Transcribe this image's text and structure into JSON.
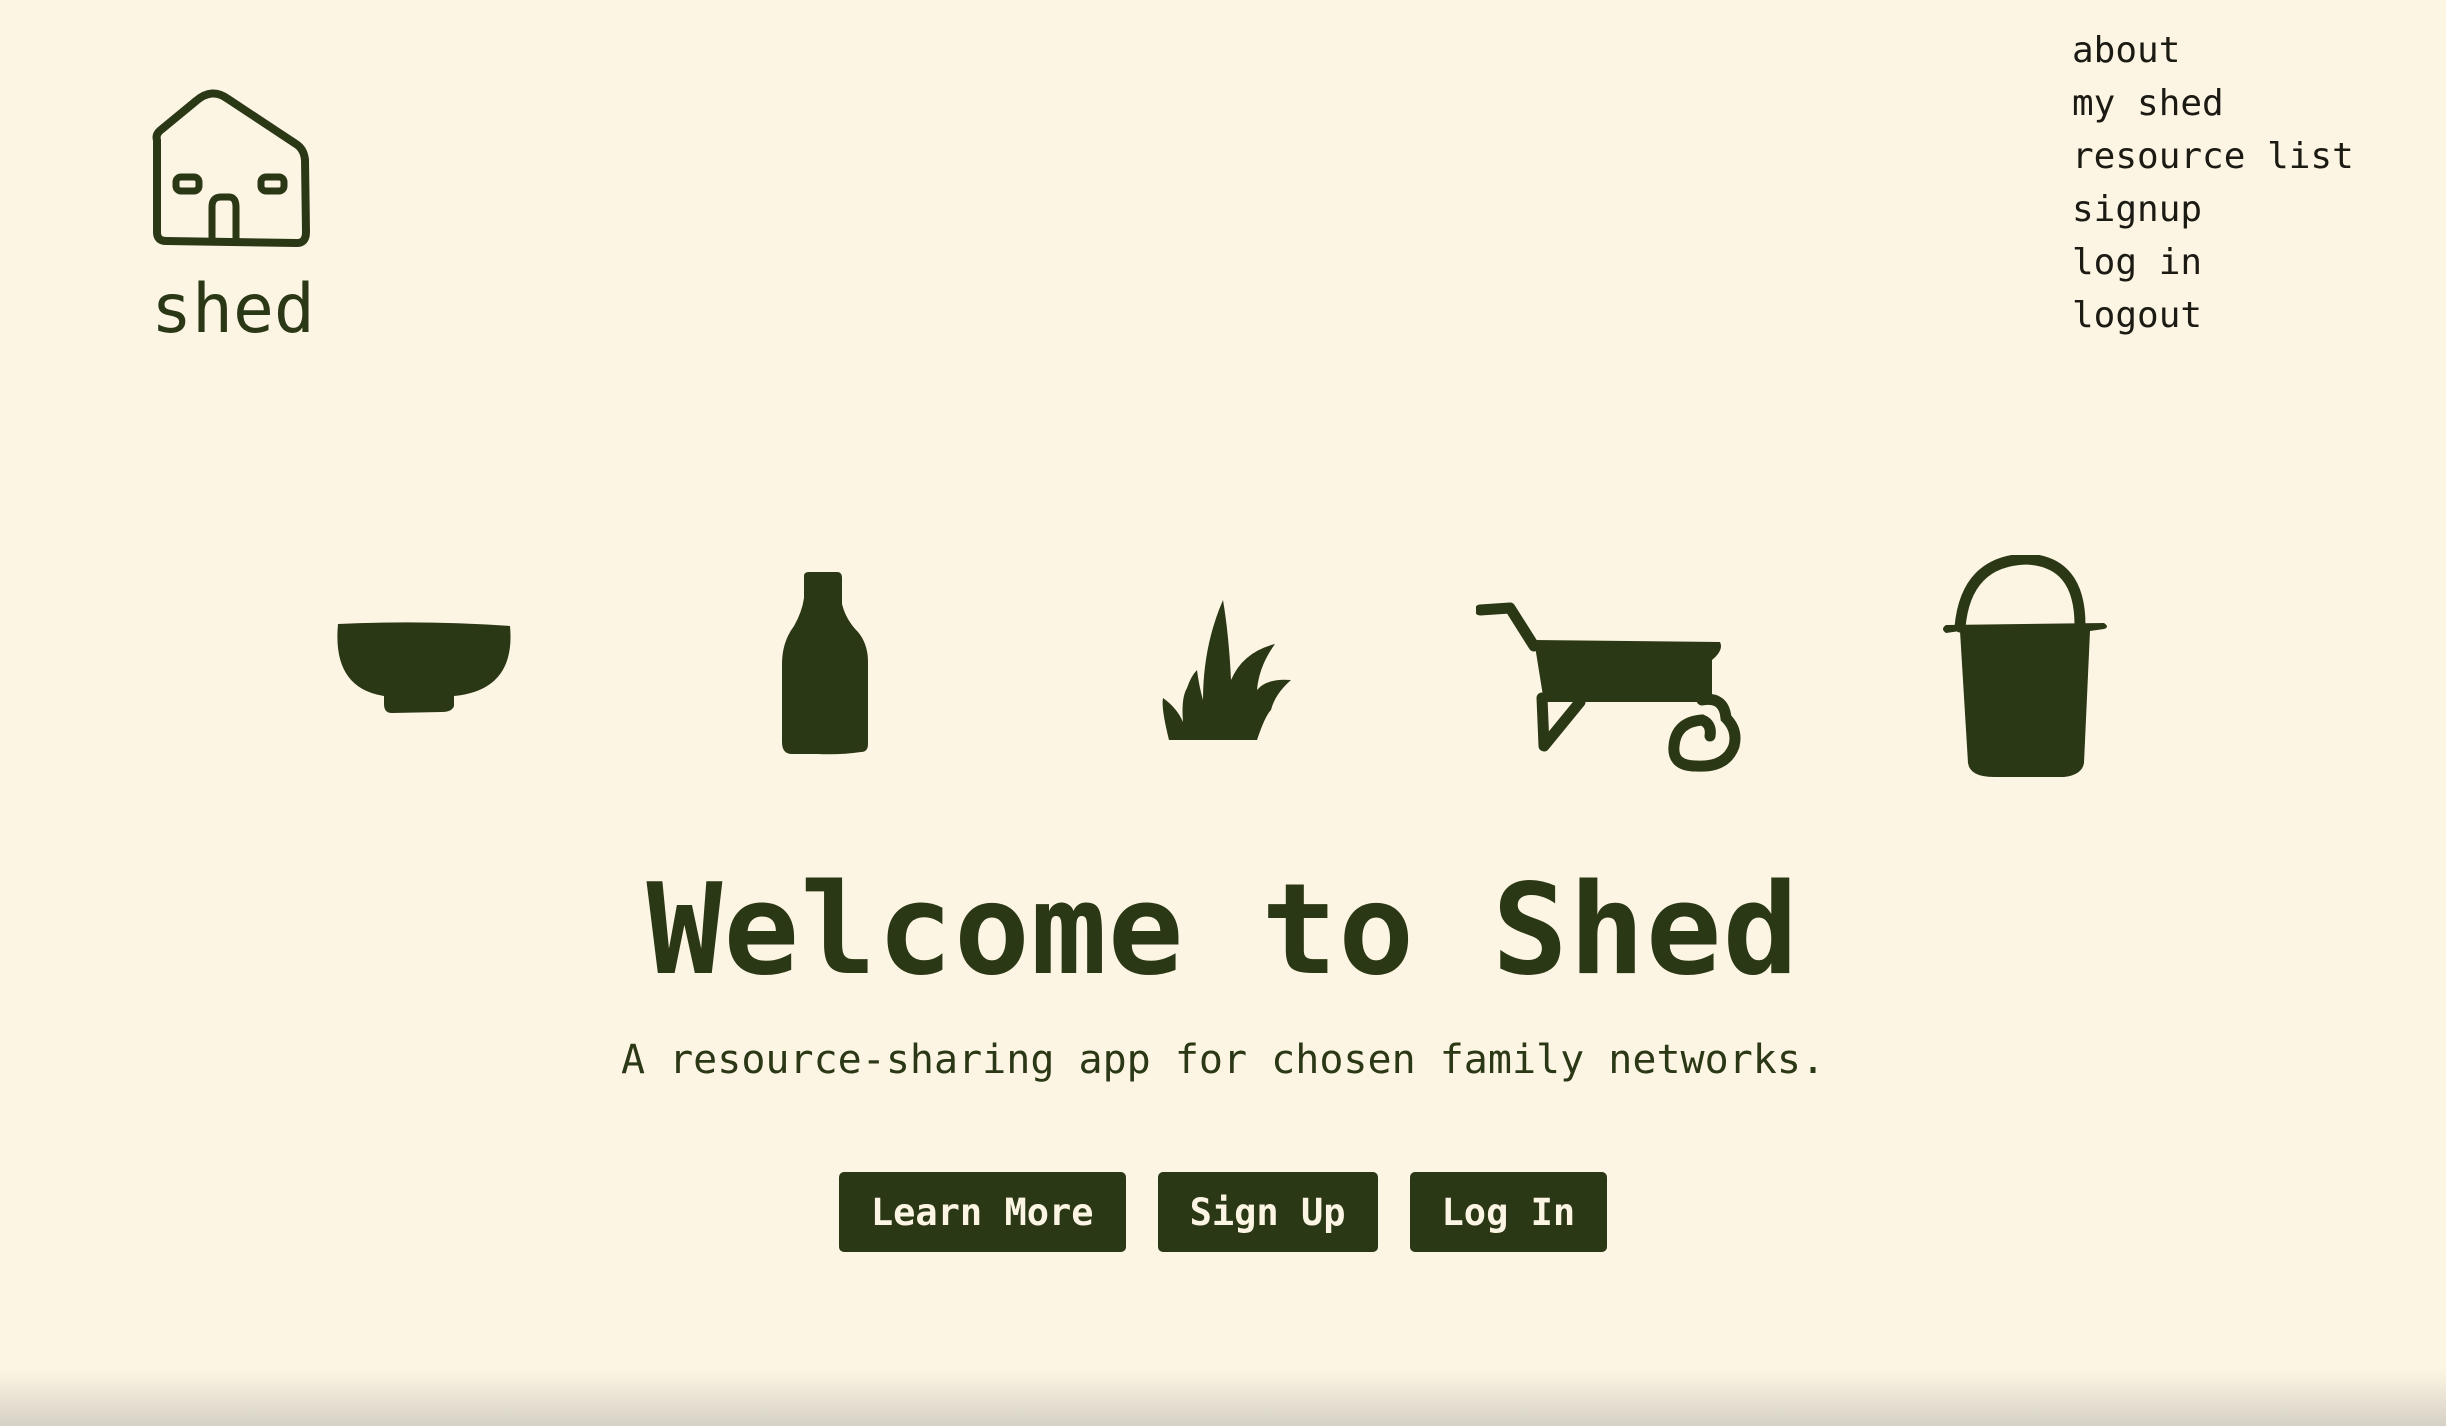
{
  "logo": {
    "text": "shed",
    "icon": "house-icon"
  },
  "nav": {
    "items": [
      {
        "label": "about"
      },
      {
        "label": "my shed"
      },
      {
        "label": "resource list"
      },
      {
        "label": "signup"
      },
      {
        "label": "log in"
      },
      {
        "label": "logout"
      }
    ]
  },
  "hero_icons": [
    "bowl-icon",
    "bottle-icon",
    "plant-icon",
    "wheelbarrow-icon",
    "bucket-icon"
  ],
  "hero": {
    "title": "Welcome to Shed",
    "subtitle": "A resource-sharing app for chosen family networks."
  },
  "buttons": {
    "learn_more": "Learn More",
    "sign_up": "Sign Up",
    "log_in": "Log In"
  },
  "colors": {
    "background": "#fdf5e3",
    "accent": "#2b3816",
    "nav_text": "#1b1b14"
  }
}
